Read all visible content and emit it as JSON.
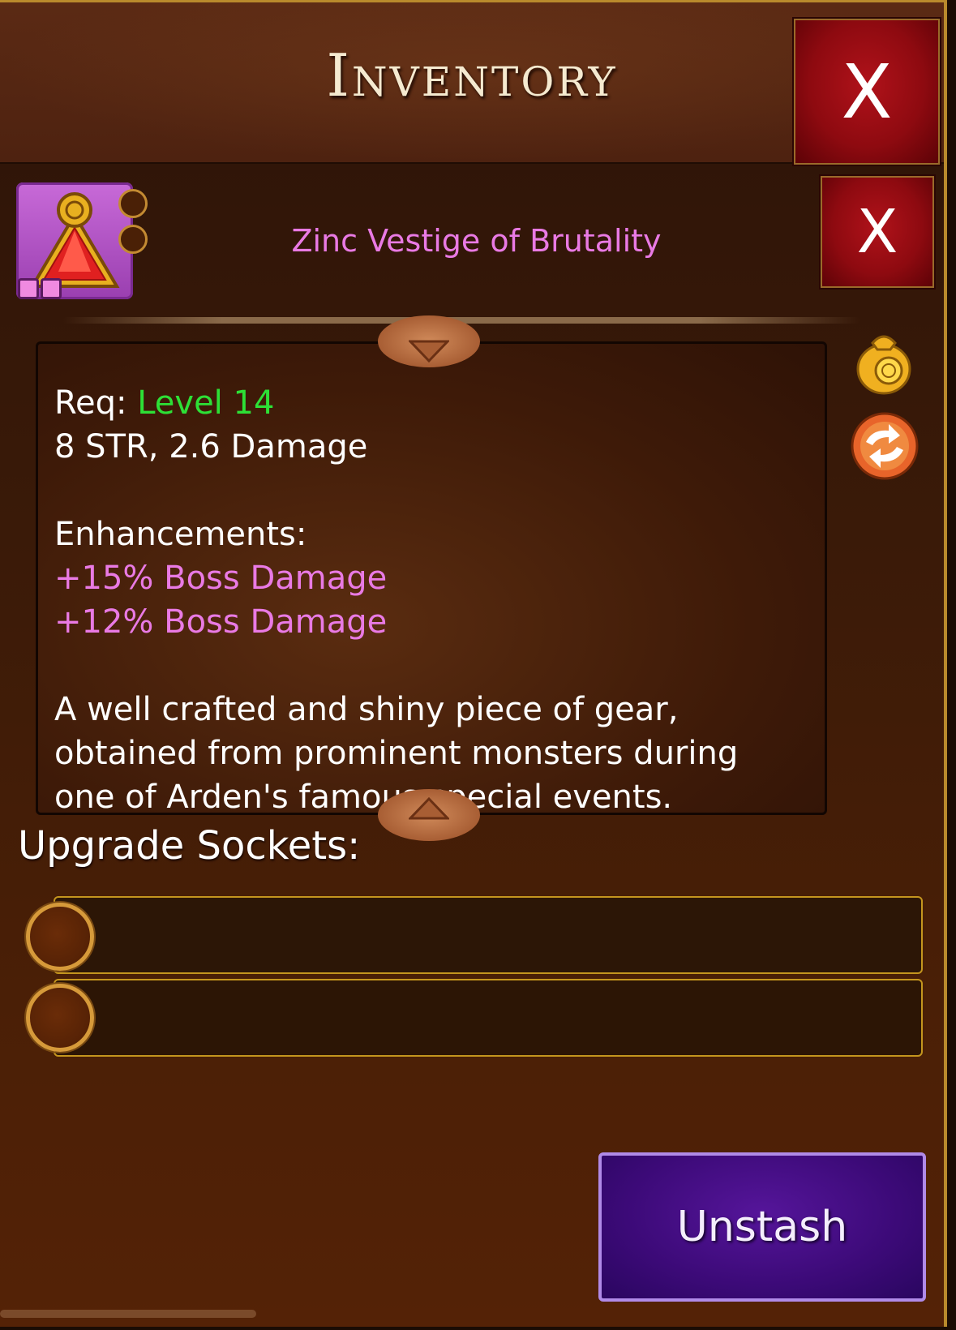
{
  "window": {
    "title": "Inventory",
    "close_label": "X"
  },
  "item": {
    "name": "Zinc Vestige of Brutality",
    "close_label": "X",
    "requirement_label": "Req:",
    "requirement_value": "Level 14",
    "stats": "8 STR, 2.6 Damage",
    "enhancements_label": "Enhancements:",
    "enhancements": [
      "+15% Boss Damage",
      "+12% Boss Damage"
    ],
    "description_lines": [
      "A well crafted and shiny piece of gear,",
      "obtained from prominent monsters during",
      "one of Arden's famous special events."
    ]
  },
  "sockets": {
    "label": "Upgrade Sockets:",
    "count": 2
  },
  "actions": {
    "unstash_label": "Unstash"
  },
  "colors": {
    "rarity_pink": "#e97ae4",
    "requirement_green": "#2de036",
    "close_red": "#a0101a",
    "unstash_purple": "#3c0a78",
    "gold_border": "#c4951e"
  },
  "icons": [
    "triangle-amulet-icon",
    "coin-bag-icon",
    "swap-arrows-icon",
    "chevron-down-icon",
    "chevron-up-icon"
  ]
}
